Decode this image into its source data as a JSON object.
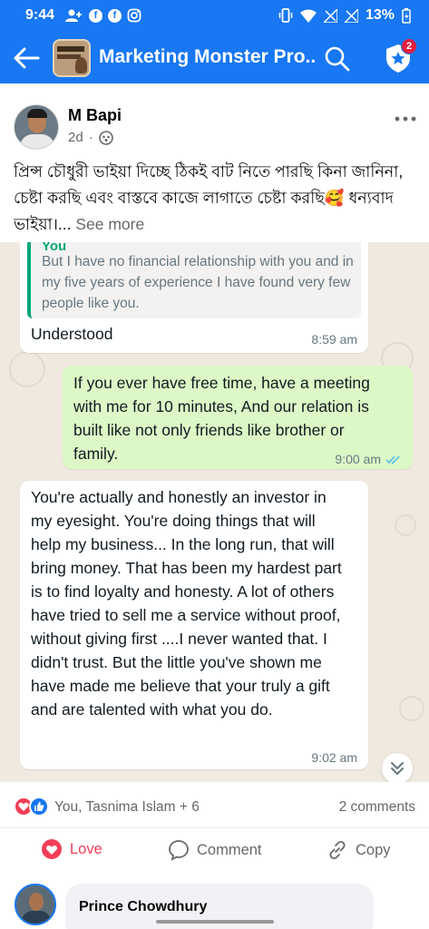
{
  "status_bar": {
    "time": "9:44",
    "battery": "13%"
  },
  "app_bar": {
    "title": "Marketing Monster Pro...",
    "notification_count": "2",
    "brand_color": "#1877f2"
  },
  "post": {
    "author": "M Bapi",
    "age": "2d",
    "text": "প্রিন্স চৌধুরী ভাইয়া দিচ্ছে ঠিকই বাট নিতে পারছি কিনা জানিনা,  চেষ্টা করছি এবং বাস্তবে  কাজে লাগাতে চেষ্টা করছি🥰 ধন্যবাদ ভাইয়া।...",
    "see_more": "See more"
  },
  "chat": {
    "quoted_name": "You",
    "quoted_text": "But I have no financial relationship with you and in my five years of experience I have found very few people like you.",
    "reply_text": "Understood",
    "reply_time": "8:59 am",
    "outgoing_text": "If you ever have free time, have a meeting with me for 10 minutes, And our relation is built like not only friends like brother or family.",
    "outgoing_time": "9:00 am",
    "incoming_text": "You're actually and honestly an investor in my eyesight. You're doing things that will help my business... In the long run, that will bring money. That has been my hardest part is to find loyalty and honesty. A lot of others have tried to sell me a service without proof, without giving first ....I never wanted that. I didn't trust. But the little you've shown me have made me believe that your truly a gift and are talented with what you do.",
    "incoming_time": "9:02 am"
  },
  "reactions": {
    "reactors": "You, Tasnima Islam + 6",
    "comments_count": "2 comments"
  },
  "actions": {
    "love": "Love",
    "comment": "Comment",
    "copy": "Copy"
  },
  "comment_preview": {
    "name": "Prince Chowdhury"
  }
}
